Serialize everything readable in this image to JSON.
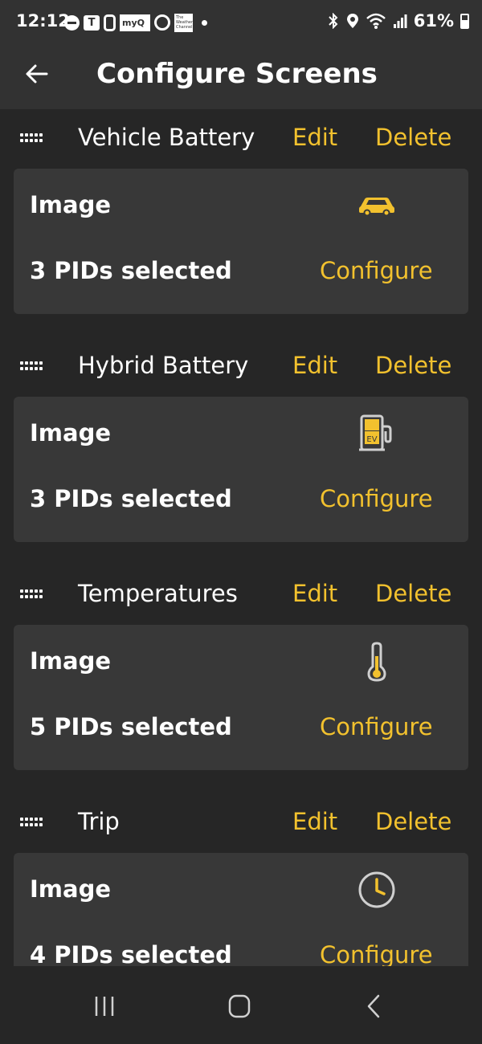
{
  "status_bar": {
    "time": "12:12",
    "battery_percent": "61%",
    "notification_icons": [
      "do-not-disturb-icon",
      "teams-icon",
      "watch-icon",
      "myq-icon",
      "alexa-icon",
      "weather-channel-icon"
    ],
    "status_icons": [
      "bluetooth-icon",
      "location-icon",
      "wifi-icon",
      "signal-icon",
      "battery-icon"
    ],
    "myq_text": "myQ",
    "weather_text": "The Weather Channel"
  },
  "app_bar": {
    "title": "Configure Screens",
    "back_icon": "back-arrow-icon"
  },
  "screens": [
    {
      "name": "Vehicle Battery",
      "edit_label": "Edit",
      "delete_label": "Delete",
      "image_label": "Image",
      "icon": "car-icon",
      "pids_label": "3 PIDs selected",
      "configure_label": "Configure"
    },
    {
      "name": "Hybrid Battery",
      "edit_label": "Edit",
      "delete_label": "Delete",
      "image_label": "Image",
      "icon": "ev-charger-icon",
      "icon_text": "EV",
      "pids_label": "3 PIDs selected",
      "configure_label": "Configure"
    },
    {
      "name": "Temperatures",
      "edit_label": "Edit",
      "delete_label": "Delete",
      "image_label": "Image",
      "icon": "thermometer-icon",
      "pids_label": "5 PIDs selected",
      "configure_label": "Configure"
    },
    {
      "name": "Trip",
      "edit_label": "Edit",
      "delete_label": "Delete",
      "image_label": "Image",
      "icon": "clock-icon",
      "pids_label": "4 PIDs selected",
      "configure_label": "Configure"
    }
  ],
  "nav_bar": {
    "buttons": [
      "recent-apps-icon",
      "home-icon",
      "back-icon"
    ]
  },
  "colors": {
    "background": "#262626",
    "app_bar": "#323232",
    "card": "#383838",
    "accent": "#f2c12e",
    "text": "#ffffff",
    "icon_gray": "#cfcfcf"
  }
}
